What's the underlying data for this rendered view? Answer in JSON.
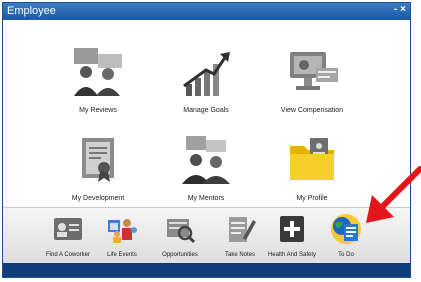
{
  "window": {
    "title": "Employee",
    "controls": "- ×"
  },
  "tiles": [
    {
      "label": "My Reviews",
      "icon": "reviews-people-icon"
    },
    {
      "label": "Manage Goals",
      "icon": "growth-chart-icon"
    },
    {
      "label": "View Compensation",
      "icon": "compensation-monitor-icon"
    },
    {
      "label": "My Development",
      "icon": "certificate-icon"
    },
    {
      "label": "My Mentors",
      "icon": "mentors-chat-icon"
    },
    {
      "label": "My Profile",
      "icon": "profile-folder-icon"
    }
  ],
  "dock": [
    {
      "label": "Find A Coworker",
      "icon": "id-card-icon"
    },
    {
      "label": "Life Events",
      "icon": "family-calendar-icon"
    },
    {
      "label": "Opportunities",
      "icon": "magnifier-doc-icon"
    },
    {
      "label": "Take Notes",
      "icon": "notepad-pencil-icon"
    },
    {
      "label": "Health And Safety",
      "icon": "plus-cross-icon"
    },
    {
      "label": "To Do",
      "icon": "globe-checklist-icon"
    }
  ],
  "colors": {
    "titlebar": "#1a5aa6",
    "statusbar": "#0f3d78",
    "arrow": "#e3161b",
    "folder": "#f2c21b",
    "highlight": "#f5c518"
  }
}
